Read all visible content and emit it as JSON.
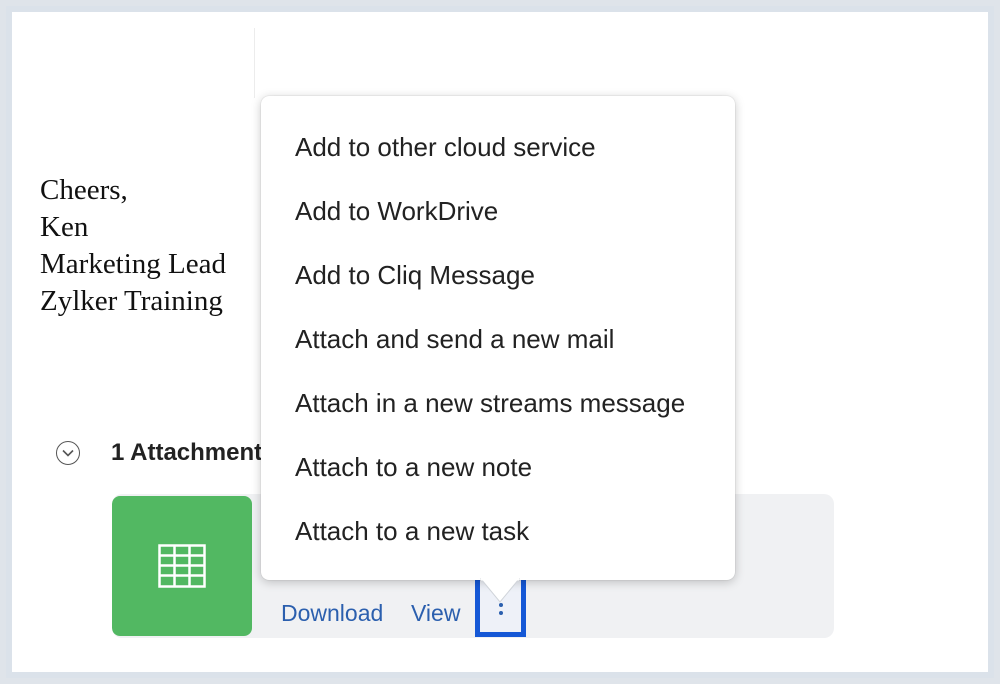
{
  "signature": {
    "lines": [
      "Cheers,",
      "Ken",
      "Marketing Lead",
      "Zylker Training"
    ]
  },
  "attachments": {
    "header_label": "1 Attachment",
    "download_label": "Download",
    "view_label": "View",
    "file_icon": "spreadsheet-grid-icon",
    "thumb_color": "#52b862"
  },
  "context_menu": {
    "items": [
      "Add to other cloud service",
      "Add to WorkDrive",
      "Add to Cliq Message",
      "Attach and send a new mail",
      "Attach in a new streams message",
      "Attach to a new note",
      "Attach to a new task"
    ]
  },
  "colors": {
    "link": "#2b5fae",
    "highlight_border": "#1558d6"
  }
}
